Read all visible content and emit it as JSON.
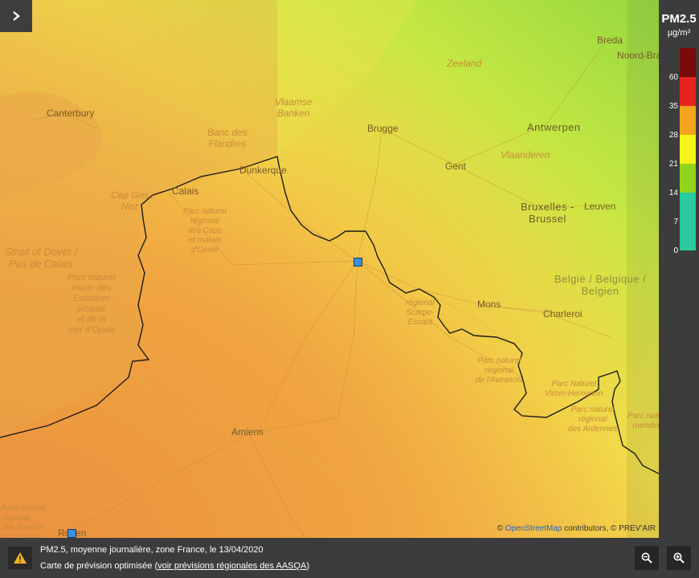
{
  "legend": {
    "title": "PM2.5",
    "unit": "µg/m³",
    "ticks": [
      "60",
      "35",
      "28",
      "21",
      "14",
      "7",
      "0"
    ],
    "colors": {
      "c60": "#7a0a0a",
      "c35": "#e8231f",
      "c28": "#f2a41e",
      "c21": "#f5f21c",
      "c14": "#8fd61b",
      "c7": "#2acb9e",
      "c0": "#2acb9e"
    }
  },
  "map": {
    "places": {
      "canterbury": "Canterbury",
      "vlaamse": "Vlaamse\nBanken",
      "banc": "Banc des\nFlandres",
      "dunkerque": "Dunkerque",
      "calais": "Calais",
      "capgris": "Cap Gris\nNez",
      "strait": "Strait of Dover /\nPas de Calais",
      "parc_marin": "Parc naturel\nmarin des\nEstuaires\npicards\net de la\nmer d'Opale",
      "parc_caps": "Parc naturel\nrégional\ndes Caps\net marais\nd'Opale",
      "brugge": "Brugge",
      "gent": "Gent",
      "antwerpen": "Antwerpen",
      "vlaanderen": "Vlaanderen",
      "zeeland": "Zeeland",
      "breda": "Breda",
      "noord": "Noord-Brabant",
      "bruxelles": "Bruxelles -\nBrussel",
      "leuven": "Leuven",
      "mons": "Mons",
      "charleroi": "Charleroi",
      "belgie": "België / Belgique /\nBelgien",
      "parc_scarpe": "régional\nScarpe-\nEscaut",
      "parc_avesnois": "Parc naturel\nrégional\nde l'Avesnois",
      "parc_viroin": "Parc Naturel\nViroin-Hermeton",
      "parc_ardennes": "Parc naturel\nrégional\ndes Ardennes",
      "parc_ardennes_east": "Parc nature\nmendion",
      "amiens": "Amiens",
      "rouen": "Rouen",
      "parc_boucles": "Parc naturel\nrégional\ndes Boucles\nde la Seine"
    }
  },
  "attribution": {
    "prefix": "©",
    "osm": "OpenStreetMap",
    "rest": "contributors, © PREV'AIR"
  },
  "footer": {
    "line1": "PM2.5, moyenne journalière, zone France, le 13/04/2020",
    "line2_prefix": "Carte de prévision optimisée (",
    "line2_link": "voir prévisions régionales des AASQA",
    "line2_suffix": ")"
  }
}
